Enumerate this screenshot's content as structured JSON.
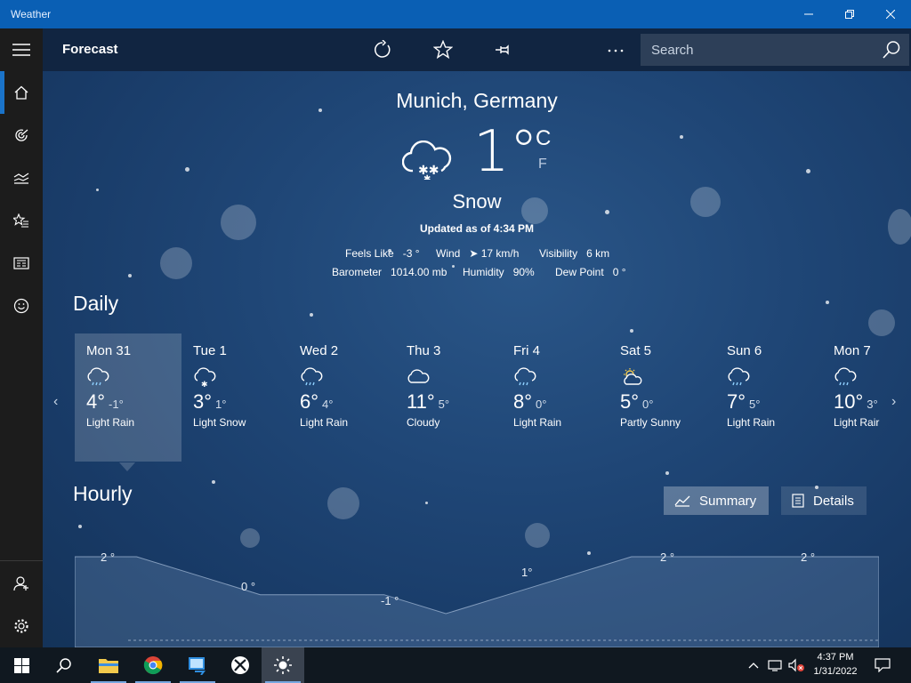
{
  "window": {
    "title": "Weather"
  },
  "commandbar": {
    "page_title": "Forecast",
    "search_placeholder": "Search",
    "icons": [
      "refresh-icon",
      "favorite-star-icon",
      "pin-icon",
      "dark-mode-moon-icon",
      "more-icon",
      "search-icon"
    ]
  },
  "nav": {
    "items": [
      "home-icon",
      "maps-radar-icon",
      "historical-weather-icon",
      "favorites-icon",
      "news-icon",
      "feedback-smiley-icon"
    ],
    "bottom": [
      "account-icon",
      "settings-icon"
    ],
    "active_index": 0
  },
  "current": {
    "city": "Munich, Germany",
    "temp": "1°",
    "unit_c": "C",
    "unit_f": "F",
    "condition": "Snow",
    "updated": "Updated as of 4:34 PM",
    "feels_like_label": "Feels Like",
    "feels_like": "-3 °",
    "wind_label": "Wind",
    "wind": "17 km/h",
    "visibility_label": "Visibility",
    "visibility": "6 km",
    "barometer_label": "Barometer",
    "barometer": "1014.00 mb",
    "humidity_label": "Humidity",
    "humidity": "90%",
    "dewpoint_label": "Dew Point",
    "dewpoint": "0 °"
  },
  "daily": {
    "title": "Daily",
    "days": [
      {
        "name": "Mon 31",
        "hi": "4°",
        "lo": "-1°",
        "cond": "Light Rain",
        "icon": "light-rain-icon"
      },
      {
        "name": "Tue 1",
        "hi": "3°",
        "lo": "1°",
        "cond": "Light Snow",
        "icon": "light-snow-icon"
      },
      {
        "name": "Wed 2",
        "hi": "6°",
        "lo": "4°",
        "cond": "Light Rain",
        "icon": "light-rain-icon"
      },
      {
        "name": "Thu 3",
        "hi": "11°",
        "lo": "5°",
        "cond": "Cloudy",
        "icon": "cloudy-icon"
      },
      {
        "name": "Fri 4",
        "hi": "8°",
        "lo": "0°",
        "cond": "Light Rain",
        "icon": "light-rain-icon"
      },
      {
        "name": "Sat 5",
        "hi": "5°",
        "lo": "0°",
        "cond": "Partly Sunny",
        "icon": "partly-sunny-icon"
      },
      {
        "name": "Sun 6",
        "hi": "7°",
        "lo": "5°",
        "cond": "Light Rain",
        "icon": "light-rain-icon"
      },
      {
        "name": "Mon 7",
        "hi": "10°",
        "lo": "3°",
        "cond": "Light Rair",
        "icon": "light-rain-icon"
      }
    ]
  },
  "hourly": {
    "title": "Hourly",
    "summary_label": "Summary",
    "details_label": "Details",
    "labels": [
      "2 °",
      "0 °",
      "-1 °",
      "1°",
      "2 °",
      "2 °"
    ],
    "temps": [
      2,
      2,
      1,
      0,
      0,
      0,
      -1,
      0,
      1,
      2,
      2,
      2,
      2,
      2
    ]
  },
  "taskbar": {
    "apps": [
      "start-icon",
      "search-icon",
      "file-explorer-icon",
      "chrome-icon",
      "remote-desktop-icon",
      "xbox-icon",
      "weather-app-icon"
    ],
    "time": "4:37 PM",
    "date": "1/31/2022"
  }
}
